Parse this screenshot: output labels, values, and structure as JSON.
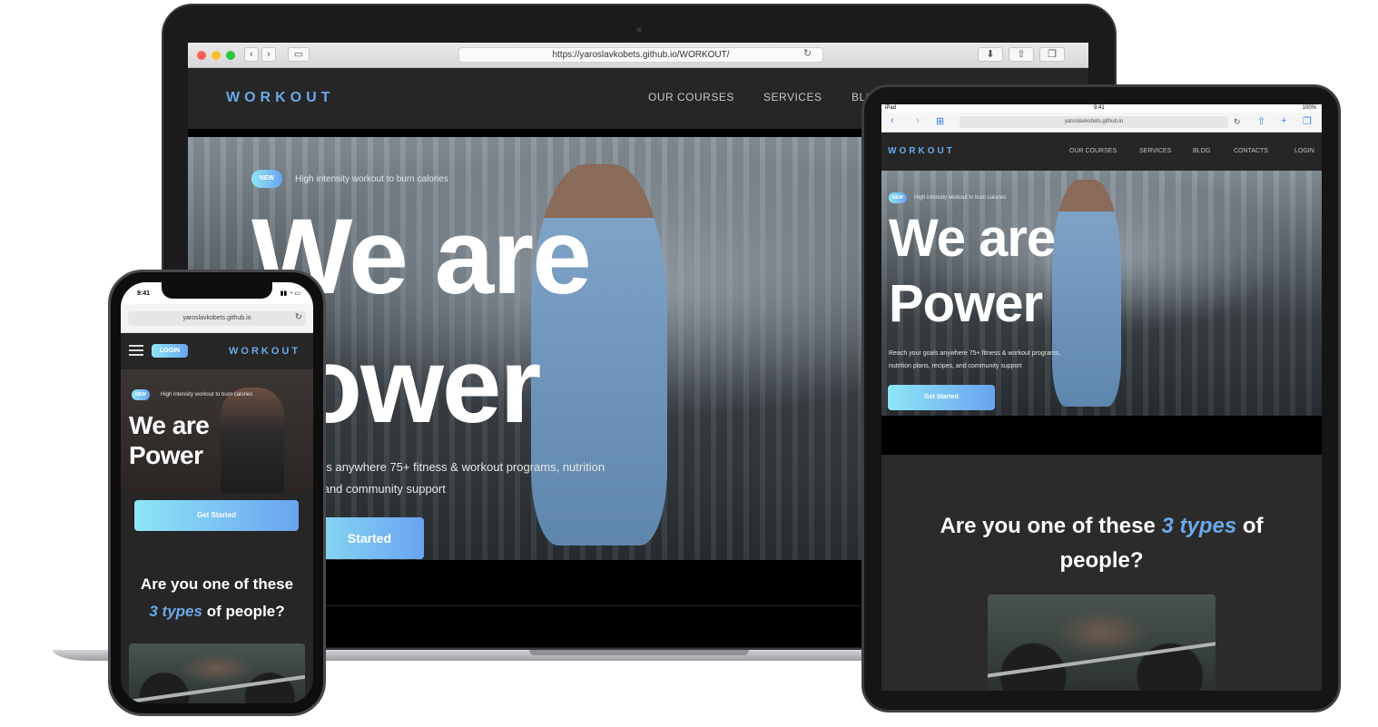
{
  "brand": {
    "logo": "WORKOUT",
    "accent_color": "#6aa8e8",
    "gradient_from": "#8ee6f5",
    "gradient_to": "#6aa3f0",
    "bg_dark": "#262626"
  },
  "laptop": {
    "url": "https://yaroslavkobets.github.io/WORKOUT/",
    "nav": [
      "OUR COURSES",
      "SERVICES",
      "BLOG"
    ],
    "badge": "NEW",
    "badge_text": "High intensity workout to burn calories",
    "heading_line1": "We are",
    "heading_line2": "ower",
    "paragraph_line1": "oals anywhere 75+ fitness & workout programs, nutrition",
    "paragraph_line2": "s, and community support",
    "cta": "Started"
  },
  "tablet": {
    "status_left": "iPad",
    "status_time": "9:41",
    "status_right": "100%",
    "url": "yaroslavkobets.github.io",
    "nav": [
      "OUR COURSES",
      "SERVICES",
      "BLOG",
      "CONTACTS",
      "LOGIN"
    ],
    "badge": "NEW",
    "badge_text": "High intensity workout to burn calories",
    "heading_line1": "We are",
    "heading_line2": "Power",
    "paragraph_line1": "Reach your goals anywhere 75+ fitness & workout programs,",
    "paragraph_line2": "nutrition plans, recipes, and community support",
    "cta": "Get Started",
    "section_title_pre": "Are you one of these",
    "section_title_accent": "3 types",
    "section_title_post": "of",
    "section_title_line2": "people?"
  },
  "phone": {
    "time": "9:41",
    "url": "yaroslavkobets.github.io",
    "login": "LOGIN",
    "badge": "NEW",
    "badge_text": "High intensity workout to burn calories",
    "heading_line1": "We are",
    "heading_line2": "Power",
    "cta": "Get Started",
    "section_title_line1": "Are you one of these",
    "section_title_accent": "3 types",
    "section_title_post": "of people?"
  }
}
